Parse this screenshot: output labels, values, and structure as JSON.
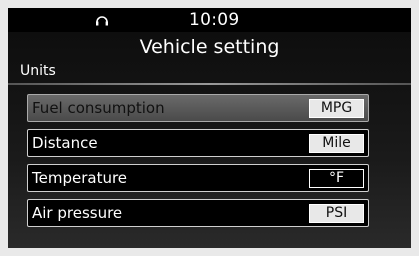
{
  "status": {
    "icon": "headset-icon",
    "time": "10:09"
  },
  "header": {
    "title": "Vehicle setting"
  },
  "section": {
    "label": "Units"
  },
  "settings": [
    {
      "label": "Fuel consumption",
      "value": "MPG",
      "selected": true
    },
    {
      "label": "Distance",
      "value": "Mile",
      "selected": false
    },
    {
      "label": "Temperature",
      "value": "°F",
      "selected": false
    },
    {
      "label": "Air pressure",
      "value": "PSI",
      "selected": false
    }
  ],
  "colors": {
    "selected_row": "#5a5a5a",
    "row_border": "#cfcfcf",
    "text": "#ffffff"
  }
}
